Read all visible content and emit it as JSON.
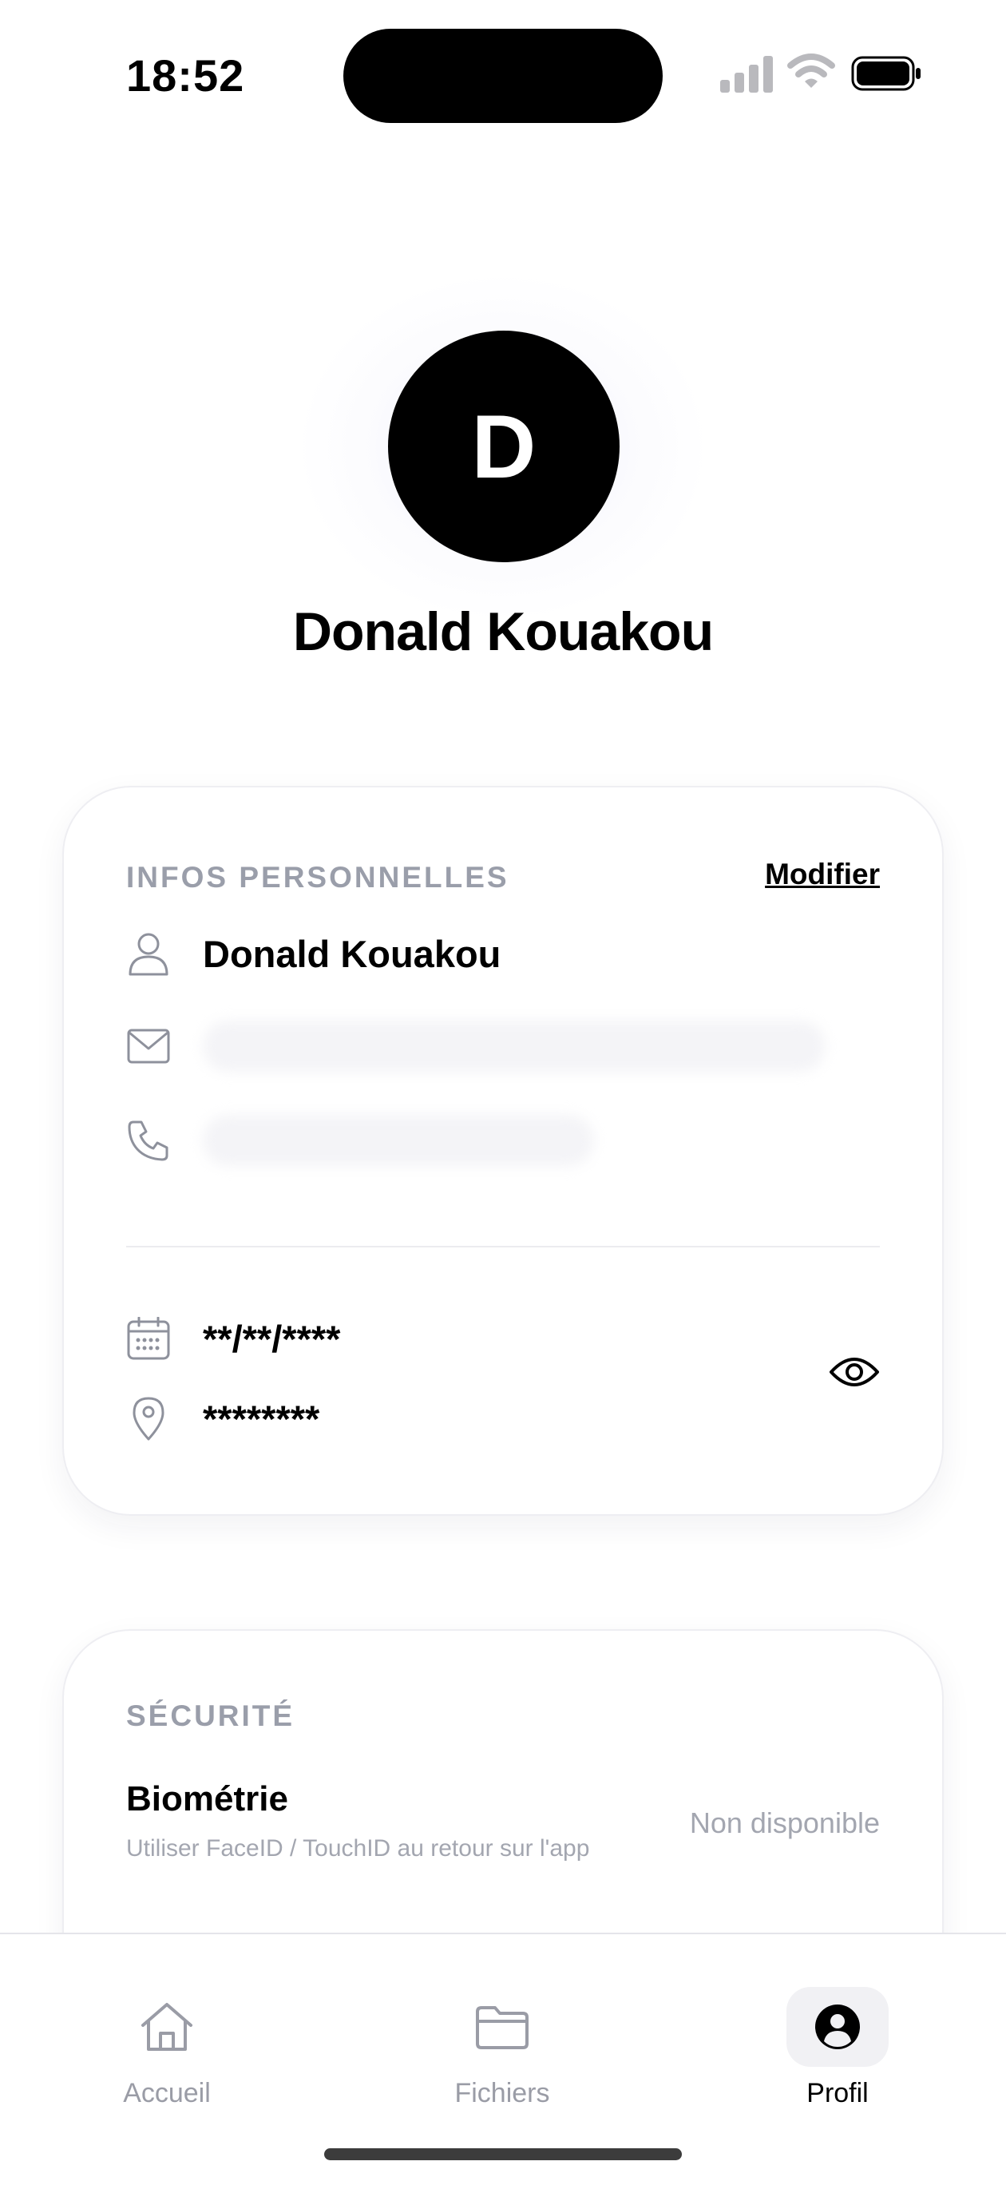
{
  "status_bar": {
    "time": "18:52"
  },
  "profile": {
    "initial": "D",
    "name": "Donald Kouakou"
  },
  "personal_info": {
    "section_title": "INFOS PERSONNELLES",
    "edit_label": "Modifier",
    "full_name": "Donald Kouakou",
    "birth_date_masked": "**/**/****",
    "birth_place_masked": "********"
  },
  "security": {
    "section_title": "SÉCURITÉ",
    "biometrics_title": "Biométrie",
    "biometrics_description": "Utiliser FaceID / TouchID au retour sur l'app",
    "biometrics_status": "Non disponible"
  },
  "tab_bar": {
    "tabs": [
      {
        "label": "Accueil",
        "icon": "home-icon"
      },
      {
        "label": "Fichiers",
        "icon": "folder-icon"
      },
      {
        "label": "Profil",
        "icon": "profile-icon",
        "active": true
      }
    ]
  },
  "colors": {
    "accent": "#000000",
    "muted": "#9a9eaa",
    "card_border": "#eeeef2"
  }
}
